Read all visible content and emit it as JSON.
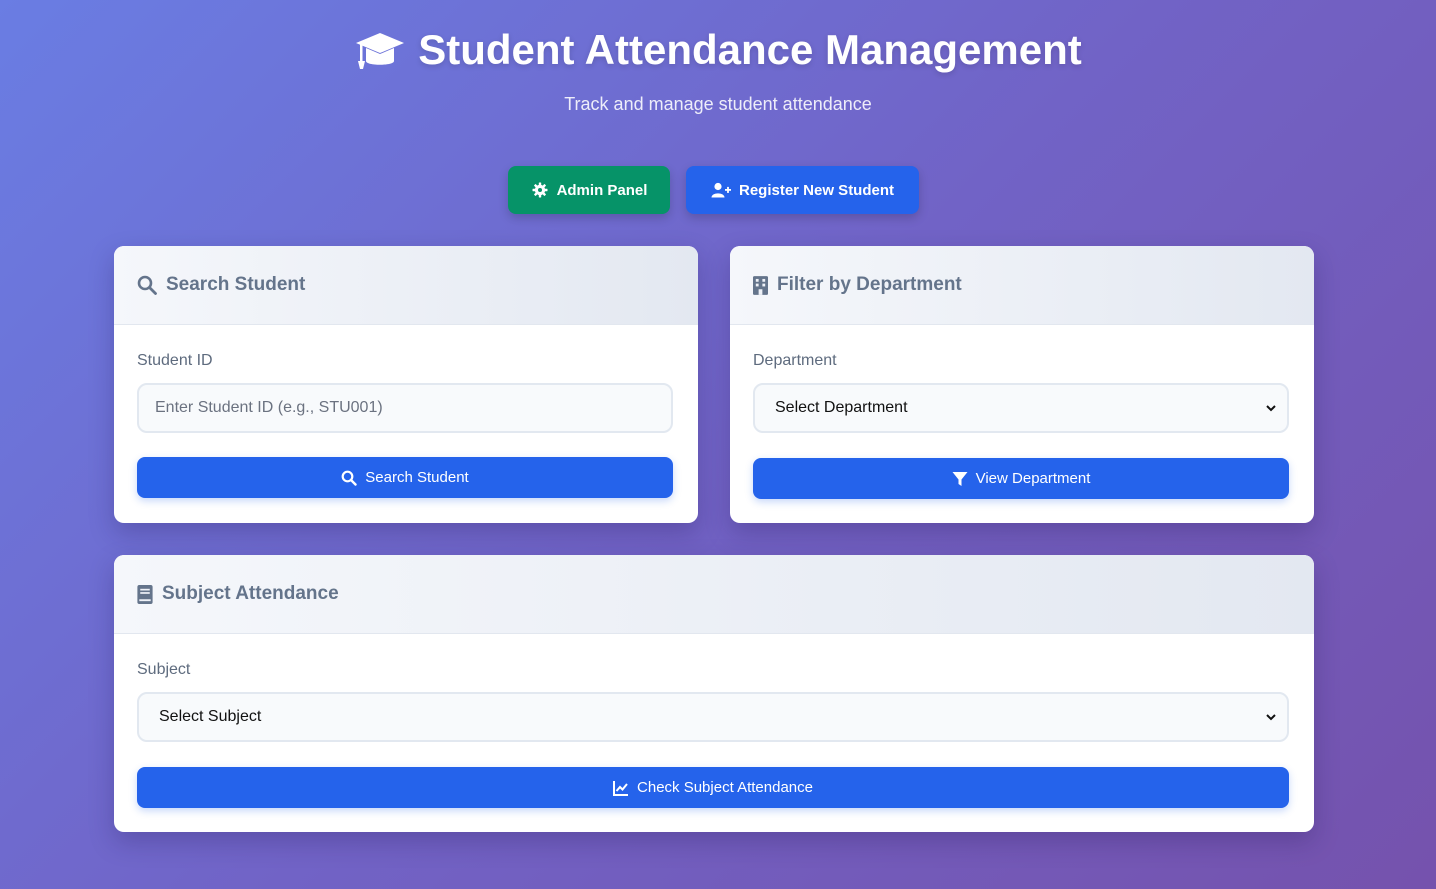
{
  "header": {
    "title": "Student Attendance Management",
    "subtitle": "Track and manage student attendance",
    "icon": "graduation-cap-icon"
  },
  "nav": {
    "admin_label": "Admin Panel",
    "register_label": "Register New Student"
  },
  "search_card": {
    "title": "Search Student",
    "field_label": "Student ID",
    "placeholder": "Enter Student ID (e.g., STU001)",
    "button_label": "Search Student"
  },
  "department_card": {
    "title": "Filter by Department",
    "field_label": "Department",
    "selected": "Select Department",
    "button_label": "View Department"
  },
  "subject_card": {
    "title": "Subject Attendance",
    "field_label": "Subject",
    "selected": "Select Subject",
    "button_label": "Check Subject Attendance"
  },
  "colors": {
    "primary": "#2563eb",
    "admin": "#069368",
    "card_heading": "#64748b"
  }
}
